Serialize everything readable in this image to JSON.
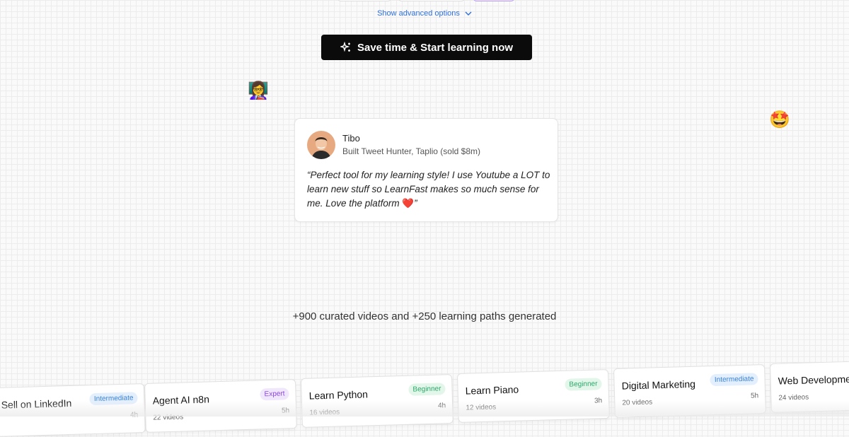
{
  "advanced_toggle": {
    "label": "Show advanced options"
  },
  "cta": {
    "label": "Save time & Start learning now"
  },
  "testimonial": {
    "name": "Tibo",
    "role": "Built Tweet Hunter, Taplio (sold $8m)",
    "quote_open": "“Perfect tool for my learning style! I use Youtube a LOT to learn new stuff so LearnFast makes so much sense for me. Love the platform ",
    "quote_heart": "❤️",
    "quote_close": "”"
  },
  "decor": {
    "teacher_emoji": "👩‍🏫",
    "star_emoji": "🤩"
  },
  "stats": {
    "text": "+900 curated videos and +250 learning paths generated"
  },
  "courses": [
    {
      "title": "Sell on LinkedIn",
      "badge": "Intermediate",
      "level": "intermediate",
      "videos": "",
      "hours": "4h"
    },
    {
      "title": "Agent AI n8n",
      "badge": "Expert",
      "level": "expert",
      "videos": "22 videos",
      "hours": "5h"
    },
    {
      "title": "Learn Python",
      "badge": "Beginner",
      "level": "beginner",
      "videos": "16 videos",
      "hours": "4h"
    },
    {
      "title": "Learn Piano",
      "badge": "Beginner",
      "level": "beginner",
      "videos": "12 videos",
      "hours": "3h"
    },
    {
      "title": "Digital Marketing",
      "badge": "Intermediate",
      "level": "intermediate",
      "videos": "20 videos",
      "hours": "5h"
    },
    {
      "title": "Web Development",
      "badge": "",
      "level": "",
      "videos": "24 videos",
      "hours": ""
    }
  ]
}
